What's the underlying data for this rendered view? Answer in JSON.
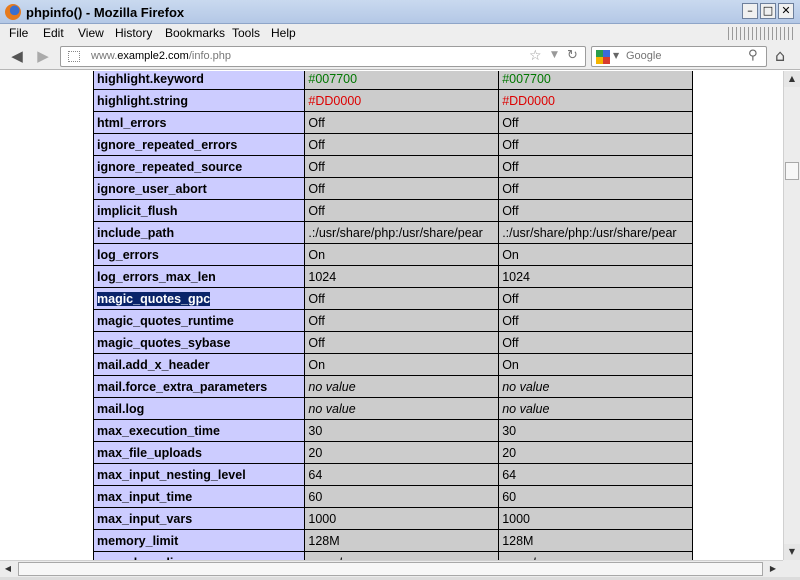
{
  "window": {
    "title": "phpinfo() - Mozilla Firefox",
    "min_glyph": "–",
    "max_glyph": "□",
    "close_glyph": "✕"
  },
  "menu": [
    "File",
    "Edit",
    "View",
    "History",
    "Bookmarks",
    "Tools",
    "Help"
  ],
  "nav": {
    "back_glyph": "◀",
    "forward_glyph": "▶",
    "url_prefix": "www.",
    "url_host": "example2.com",
    "url_path": "/info.php",
    "search_placeholder": "Google",
    "star_glyph": "☆",
    "drop_glyph": "▼",
    "reload_glyph": "↻",
    "search_go_glyph": "⚲",
    "home_glyph": "⌂"
  },
  "colors": {
    "keyword_green": "#007700",
    "string_red": "#DD0000",
    "label_bg": "#ccccff",
    "value_bg": "#cccccc"
  },
  "rows": [
    {
      "key": "highlight.keyword",
      "local": "#007700",
      "master": "#007700",
      "style": "green"
    },
    {
      "key": "highlight.string",
      "local": "#DD0000",
      "master": "#DD0000",
      "style": "red"
    },
    {
      "key": "html_errors",
      "local": "Off",
      "master": "Off"
    },
    {
      "key": "ignore_repeated_errors",
      "local": "Off",
      "master": "Off"
    },
    {
      "key": "ignore_repeated_source",
      "local": "Off",
      "master": "Off"
    },
    {
      "key": "ignore_user_abort",
      "local": "Off",
      "master": "Off"
    },
    {
      "key": "implicit_flush",
      "local": "Off",
      "master": "Off"
    },
    {
      "key": "include_path",
      "local": ".:/usr/share/php:/usr/share/pear",
      "master": ".:/usr/share/php:/usr/share/pear"
    },
    {
      "key": "log_errors",
      "local": "On",
      "master": "On"
    },
    {
      "key": "log_errors_max_len",
      "local": "1024",
      "master": "1024"
    },
    {
      "key": "magic_quotes_gpc",
      "local": "Off",
      "master": "Off",
      "selected": true
    },
    {
      "key": "magic_quotes_runtime",
      "local": "Off",
      "master": "Off"
    },
    {
      "key": "magic_quotes_sybase",
      "local": "Off",
      "master": "Off"
    },
    {
      "key": "mail.add_x_header",
      "local": "On",
      "master": "On"
    },
    {
      "key": "mail.force_extra_parameters",
      "local": "no value",
      "master": "no value",
      "italic": true
    },
    {
      "key": "mail.log",
      "local": "no value",
      "master": "no value",
      "italic": true
    },
    {
      "key": "max_execution_time",
      "local": "30",
      "master": "30"
    },
    {
      "key": "max_file_uploads",
      "local": "20",
      "master": "20"
    },
    {
      "key": "max_input_nesting_level",
      "local": "64",
      "master": "64"
    },
    {
      "key": "max_input_time",
      "local": "60",
      "master": "60"
    },
    {
      "key": "max_input_vars",
      "local": "1000",
      "master": "1000"
    },
    {
      "key": "memory_limit",
      "local": "128M",
      "master": "128M"
    },
    {
      "key": "open_basedir",
      "local": "no value",
      "master": "no value",
      "italic": true
    }
  ]
}
